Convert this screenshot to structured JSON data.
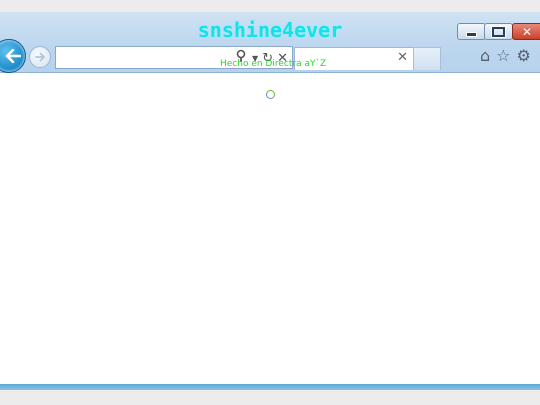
{
  "watermark": "snshine4ever",
  "status_text": "Hecho en Directra aY`Z",
  "address_bar": {
    "value": ""
  },
  "tab": {
    "title": ""
  },
  "icons": {
    "back": "back-arrow-icon",
    "forward": "forward-arrow-icon",
    "search": "search-icon",
    "dropdown": "chevron-down-icon",
    "refresh": "refresh-icon",
    "stop": "stop-icon",
    "close_tab": "close-icon",
    "home": "home-icon",
    "favorites": "star-icon",
    "tools": "gear-icon"
  },
  "colors": {
    "chrome": "#bcd6ee",
    "watermark": "#16e0e8",
    "close_button": "#c9412a",
    "back_button": "#1787c9",
    "status_text": "#22dd22"
  }
}
